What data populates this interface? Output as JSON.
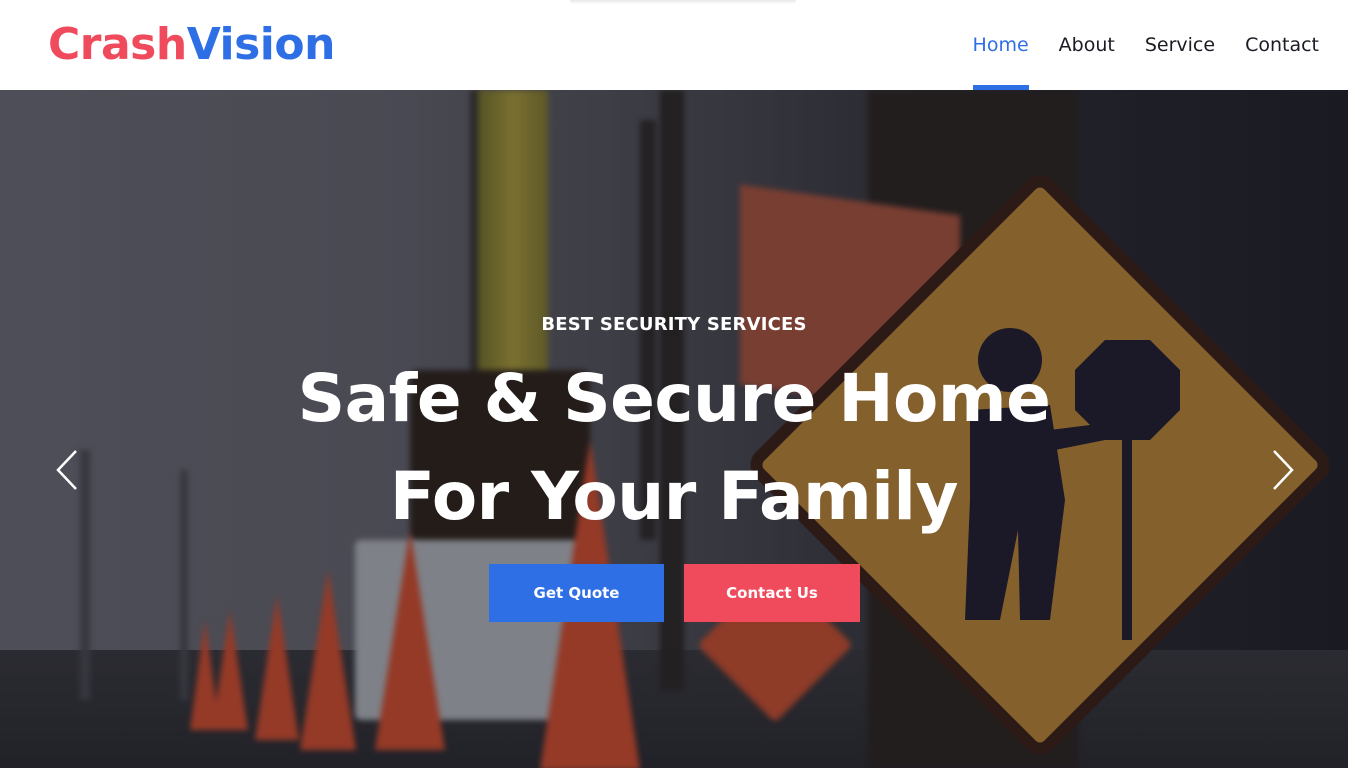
{
  "brand": {
    "name_part1": "Crash",
    "name_part2": "Vision",
    "color_primary": "#2f6fe6",
    "color_accent": "#ef4b5c"
  },
  "nav": {
    "items": [
      {
        "label": "Home",
        "active": true
      },
      {
        "label": "About",
        "active": false
      },
      {
        "label": "Service",
        "active": false
      },
      {
        "label": "Contact",
        "active": false
      }
    ]
  },
  "hero": {
    "eyebrow": "BEST SECURITY SERVICES",
    "headline_line1": "Safe & Secure Home",
    "headline_line2": "For Your Family",
    "primary_button": "Get Quote",
    "secondary_button": "Contact Us",
    "prev_icon": "chevron-left-icon",
    "next_icon": "chevron-right-icon",
    "background_image": "road-work-signs-and-traffic-cones"
  }
}
